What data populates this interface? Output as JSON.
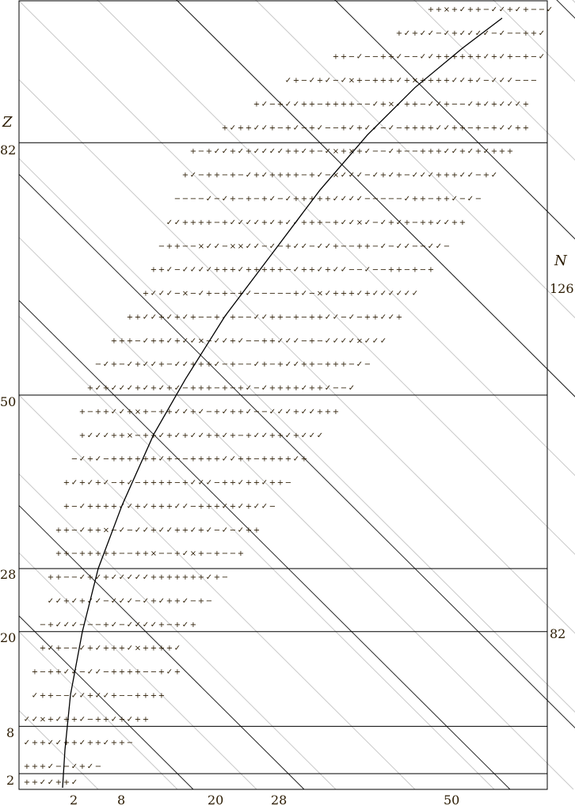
{
  "chart_data": {
    "type": "scatter",
    "title": "",
    "xlabel": "N",
    "ylabel": "Z",
    "xlim": [
      0,
      67
    ],
    "ylim": [
      0,
      100
    ],
    "x_ticks": [
      "2",
      "8",
      "20",
      "28",
      "50"
    ],
    "y_ticks": [
      "2",
      "8",
      "20",
      "28",
      "50",
      "82"
    ],
    "magic_numbers": {
      "Z": [
        2,
        8,
        20,
        28,
        50,
        82
      ],
      "N": [
        2,
        8,
        20,
        28,
        50,
        82,
        126
      ],
      "N_labels_right": [
        "82",
        "126"
      ]
    },
    "mark_symbols": [
      "✓",
      "+",
      "−",
      "×"
    ],
    "colors": {
      "frame": "#000000",
      "magic_line": "#000000",
      "isobar_line": "#c8c8c8",
      "stability_line": "#000000",
      "check": "#22c022",
      "plus": "#33cc33",
      "minus": "#66cc66",
      "plus_red": "#e83030",
      "plus_pink": "#f0a0b4",
      "cross": "#e8b800"
    },
    "series": [
      {
        "name": "",
        "comment_values_are_Z_to_chart_y": true,
        "bands": [
          {
            "z": 1,
            "n_from": 1,
            "n_to": 7
          },
          {
            "z": 3,
            "n_from": 1,
            "n_to": 10
          },
          {
            "z": 6,
            "n_from": 1,
            "n_to": 14
          },
          {
            "z": 9,
            "n_from": 1,
            "n_to": 16
          },
          {
            "z": 12,
            "n_from": 2,
            "n_to": 18
          },
          {
            "z": 15,
            "n_from": 2,
            "n_to": 20
          },
          {
            "z": 18,
            "n_from": 3,
            "n_to": 20
          },
          {
            "z": 21,
            "n_from": 3,
            "n_to": 22
          },
          {
            "z": 24,
            "n_from": 4,
            "n_to": 24
          },
          {
            "z": 27,
            "n_from": 4,
            "n_to": 26
          },
          {
            "z": 30,
            "n_from": 5,
            "n_to": 28
          },
          {
            "z": 33,
            "n_from": 5,
            "n_to": 30
          },
          {
            "z": 36,
            "n_from": 6,
            "n_to": 32
          },
          {
            "z": 39,
            "n_from": 6,
            "n_to": 34
          },
          {
            "z": 42,
            "n_from": 7,
            "n_to": 36
          },
          {
            "z": 45,
            "n_from": 8,
            "n_to": 38
          },
          {
            "z": 48,
            "n_from": 8,
            "n_to": 40
          },
          {
            "z": 51,
            "n_from": 9,
            "n_to": 42
          },
          {
            "z": 54,
            "n_from": 10,
            "n_to": 44
          },
          {
            "z": 57,
            "n_from": 12,
            "n_to": 46
          },
          {
            "z": 60,
            "n_from": 14,
            "n_to": 48
          },
          {
            "z": 63,
            "n_from": 16,
            "n_to": 50
          },
          {
            "z": 66,
            "n_from": 17,
            "n_to": 52
          },
          {
            "z": 69,
            "n_from": 18,
            "n_to": 54
          },
          {
            "z": 72,
            "n_from": 19,
            "n_to": 56
          },
          {
            "z": 75,
            "n_from": 20,
            "n_to": 58
          },
          {
            "z": 78,
            "n_from": 21,
            "n_to": 60
          },
          {
            "z": 81,
            "n_from": 22,
            "n_to": 62
          },
          {
            "z": 84,
            "n_from": 26,
            "n_to": 64
          },
          {
            "z": 87,
            "n_from": 30,
            "n_to": 64
          },
          {
            "z": 90,
            "n_from": 34,
            "n_to": 65
          },
          {
            "z": 93,
            "n_from": 40,
            "n_to": 66
          },
          {
            "z": 96,
            "n_from": 48,
            "n_to": 66
          },
          {
            "z": 99,
            "n_from": 52,
            "n_to": 67
          }
        ]
      }
    ],
    "stability_curve": [
      {
        "n": 5.5,
        "z": 0.2
      },
      {
        "n": 5.8,
        "z": 5
      },
      {
        "n": 6.5,
        "z": 12
      },
      {
        "n": 8,
        "z": 20
      },
      {
        "n": 10,
        "z": 28
      },
      {
        "n": 13,
        "z": 36
      },
      {
        "n": 17,
        "z": 45
      },
      {
        "n": 21,
        "z": 52
      },
      {
        "n": 26,
        "z": 60
      },
      {
        "n": 32,
        "z": 68
      },
      {
        "n": 38,
        "z": 76
      },
      {
        "n": 44,
        "z": 83
      },
      {
        "n": 50,
        "z": 89
      },
      {
        "n": 56,
        "z": 94
      },
      {
        "n": 61,
        "z": 97.8
      }
    ]
  }
}
